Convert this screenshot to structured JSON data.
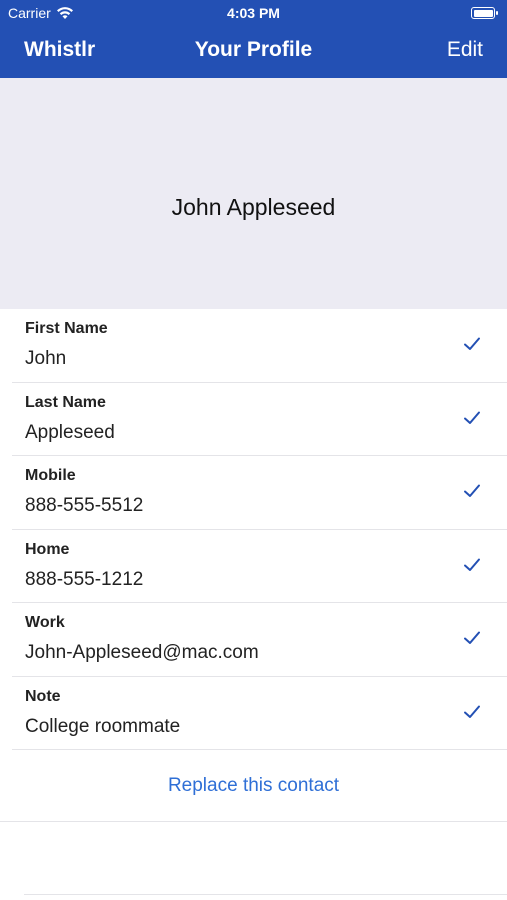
{
  "status_bar": {
    "carrier": "Carrier",
    "time": "4:03 PM"
  },
  "nav": {
    "left": "Whistlr",
    "title": "Your Profile",
    "right": "Edit"
  },
  "profile": {
    "name": "John Appleseed"
  },
  "fields": [
    {
      "label": "First Name",
      "value": "John"
    },
    {
      "label": "Last Name",
      "value": "Appleseed"
    },
    {
      "label": "Mobile",
      "value": "888-555-5512"
    },
    {
      "label": "Home",
      "value": "888-555-1212"
    },
    {
      "label": "Work",
      "value": "John-Appleseed@mac.com"
    },
    {
      "label": "Note",
      "value": "College roommate"
    }
  ],
  "actions": {
    "replace": "Replace this contact"
  },
  "colors": {
    "accent": "#2350b4",
    "link": "#2f6fd6",
    "header_bg": "#ecebf3"
  }
}
